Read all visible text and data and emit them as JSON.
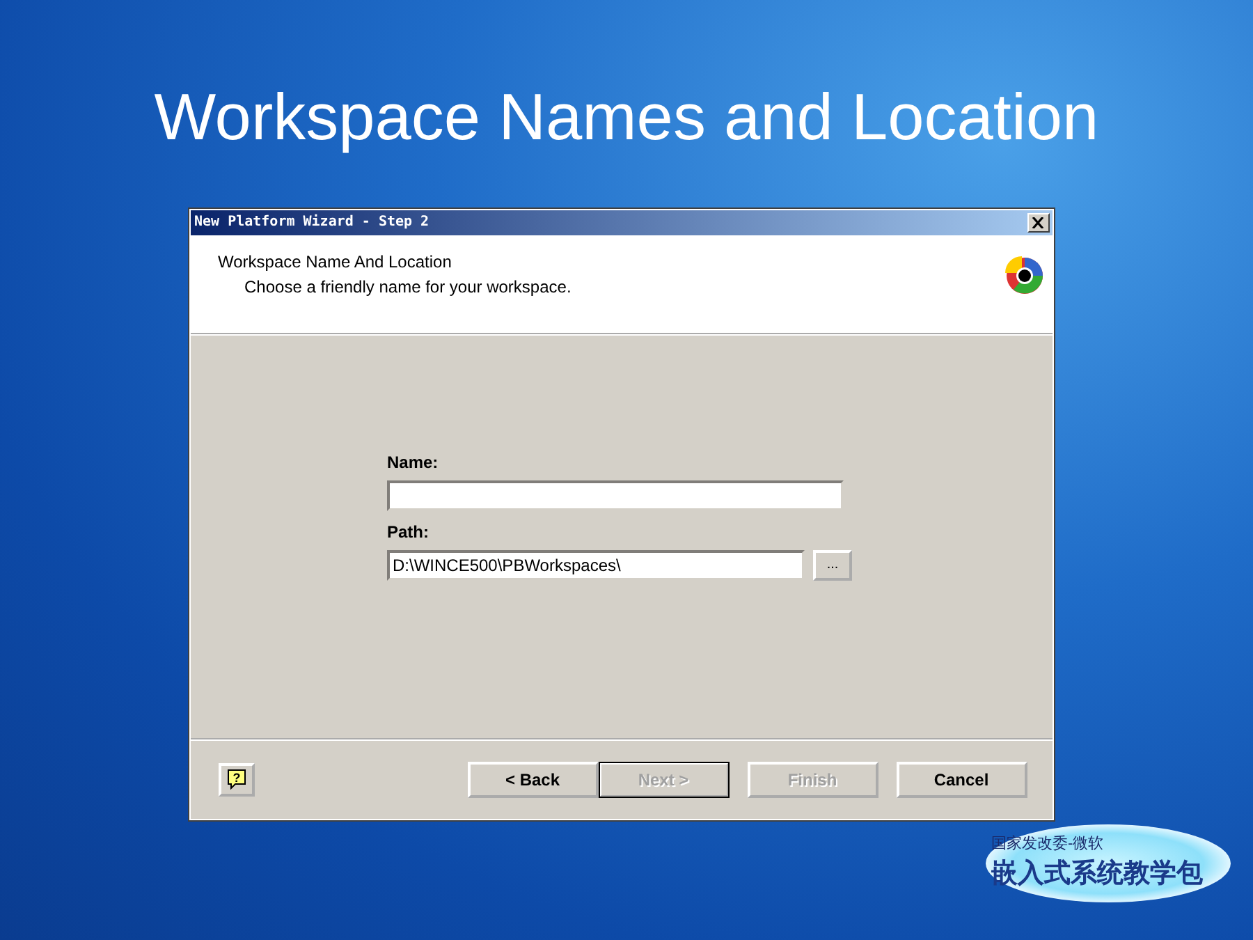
{
  "slide_title": "Workspace Names and Location",
  "dialog": {
    "title": "New Platform Wizard - Step 2",
    "header": {
      "heading": "Workspace Name And Location",
      "subheading": "Choose a friendly name for your workspace."
    },
    "fields": [
      {
        "label": "Name:",
        "browse": false
      },
      {
        "label": "Path:",
        "value": "D:\\WINCE500\\PBWorkspaces\\",
        "browse": true,
        "browse_label": "..."
      }
    ],
    "help_label": "?",
    "buttons": [
      {
        "label": "< Back",
        "disabled": false,
        "default": false
      },
      {
        "label": "Next >",
        "disabled": true,
        "default": true
      },
      {
        "label": "Finish",
        "disabled": true,
        "default": false
      },
      {
        "label": "Cancel",
        "disabled": false,
        "default": false
      }
    ]
  },
  "branding": {
    "line_1": "国家发改委-微软",
    "line_2": "嵌入式系统教学包"
  }
}
